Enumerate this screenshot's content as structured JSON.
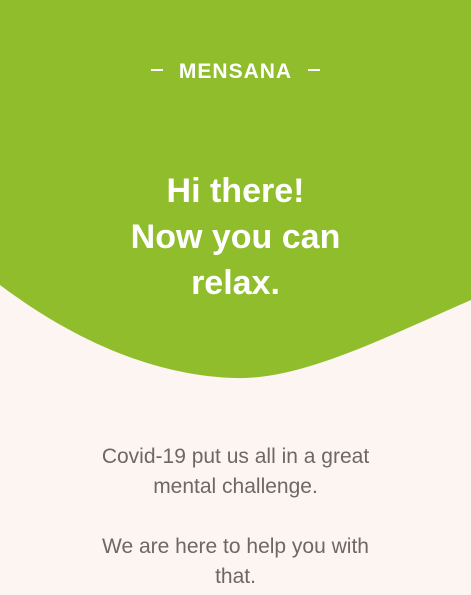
{
  "colors": {
    "hero_green": "#8fbd2b",
    "background": "#fdf5f2",
    "body_text": "#6e6767",
    "white": "#ffffff"
  },
  "brand": {
    "name": "MENSANA"
  },
  "headline": {
    "line1": "Hi there!",
    "line2": "Now you can",
    "line3": "relax."
  },
  "intro": {
    "line1": "Covid-19 put us all in a great",
    "line2": "mental challenge."
  },
  "help": {
    "line1": "We are here to help you with",
    "line2": "that."
  }
}
